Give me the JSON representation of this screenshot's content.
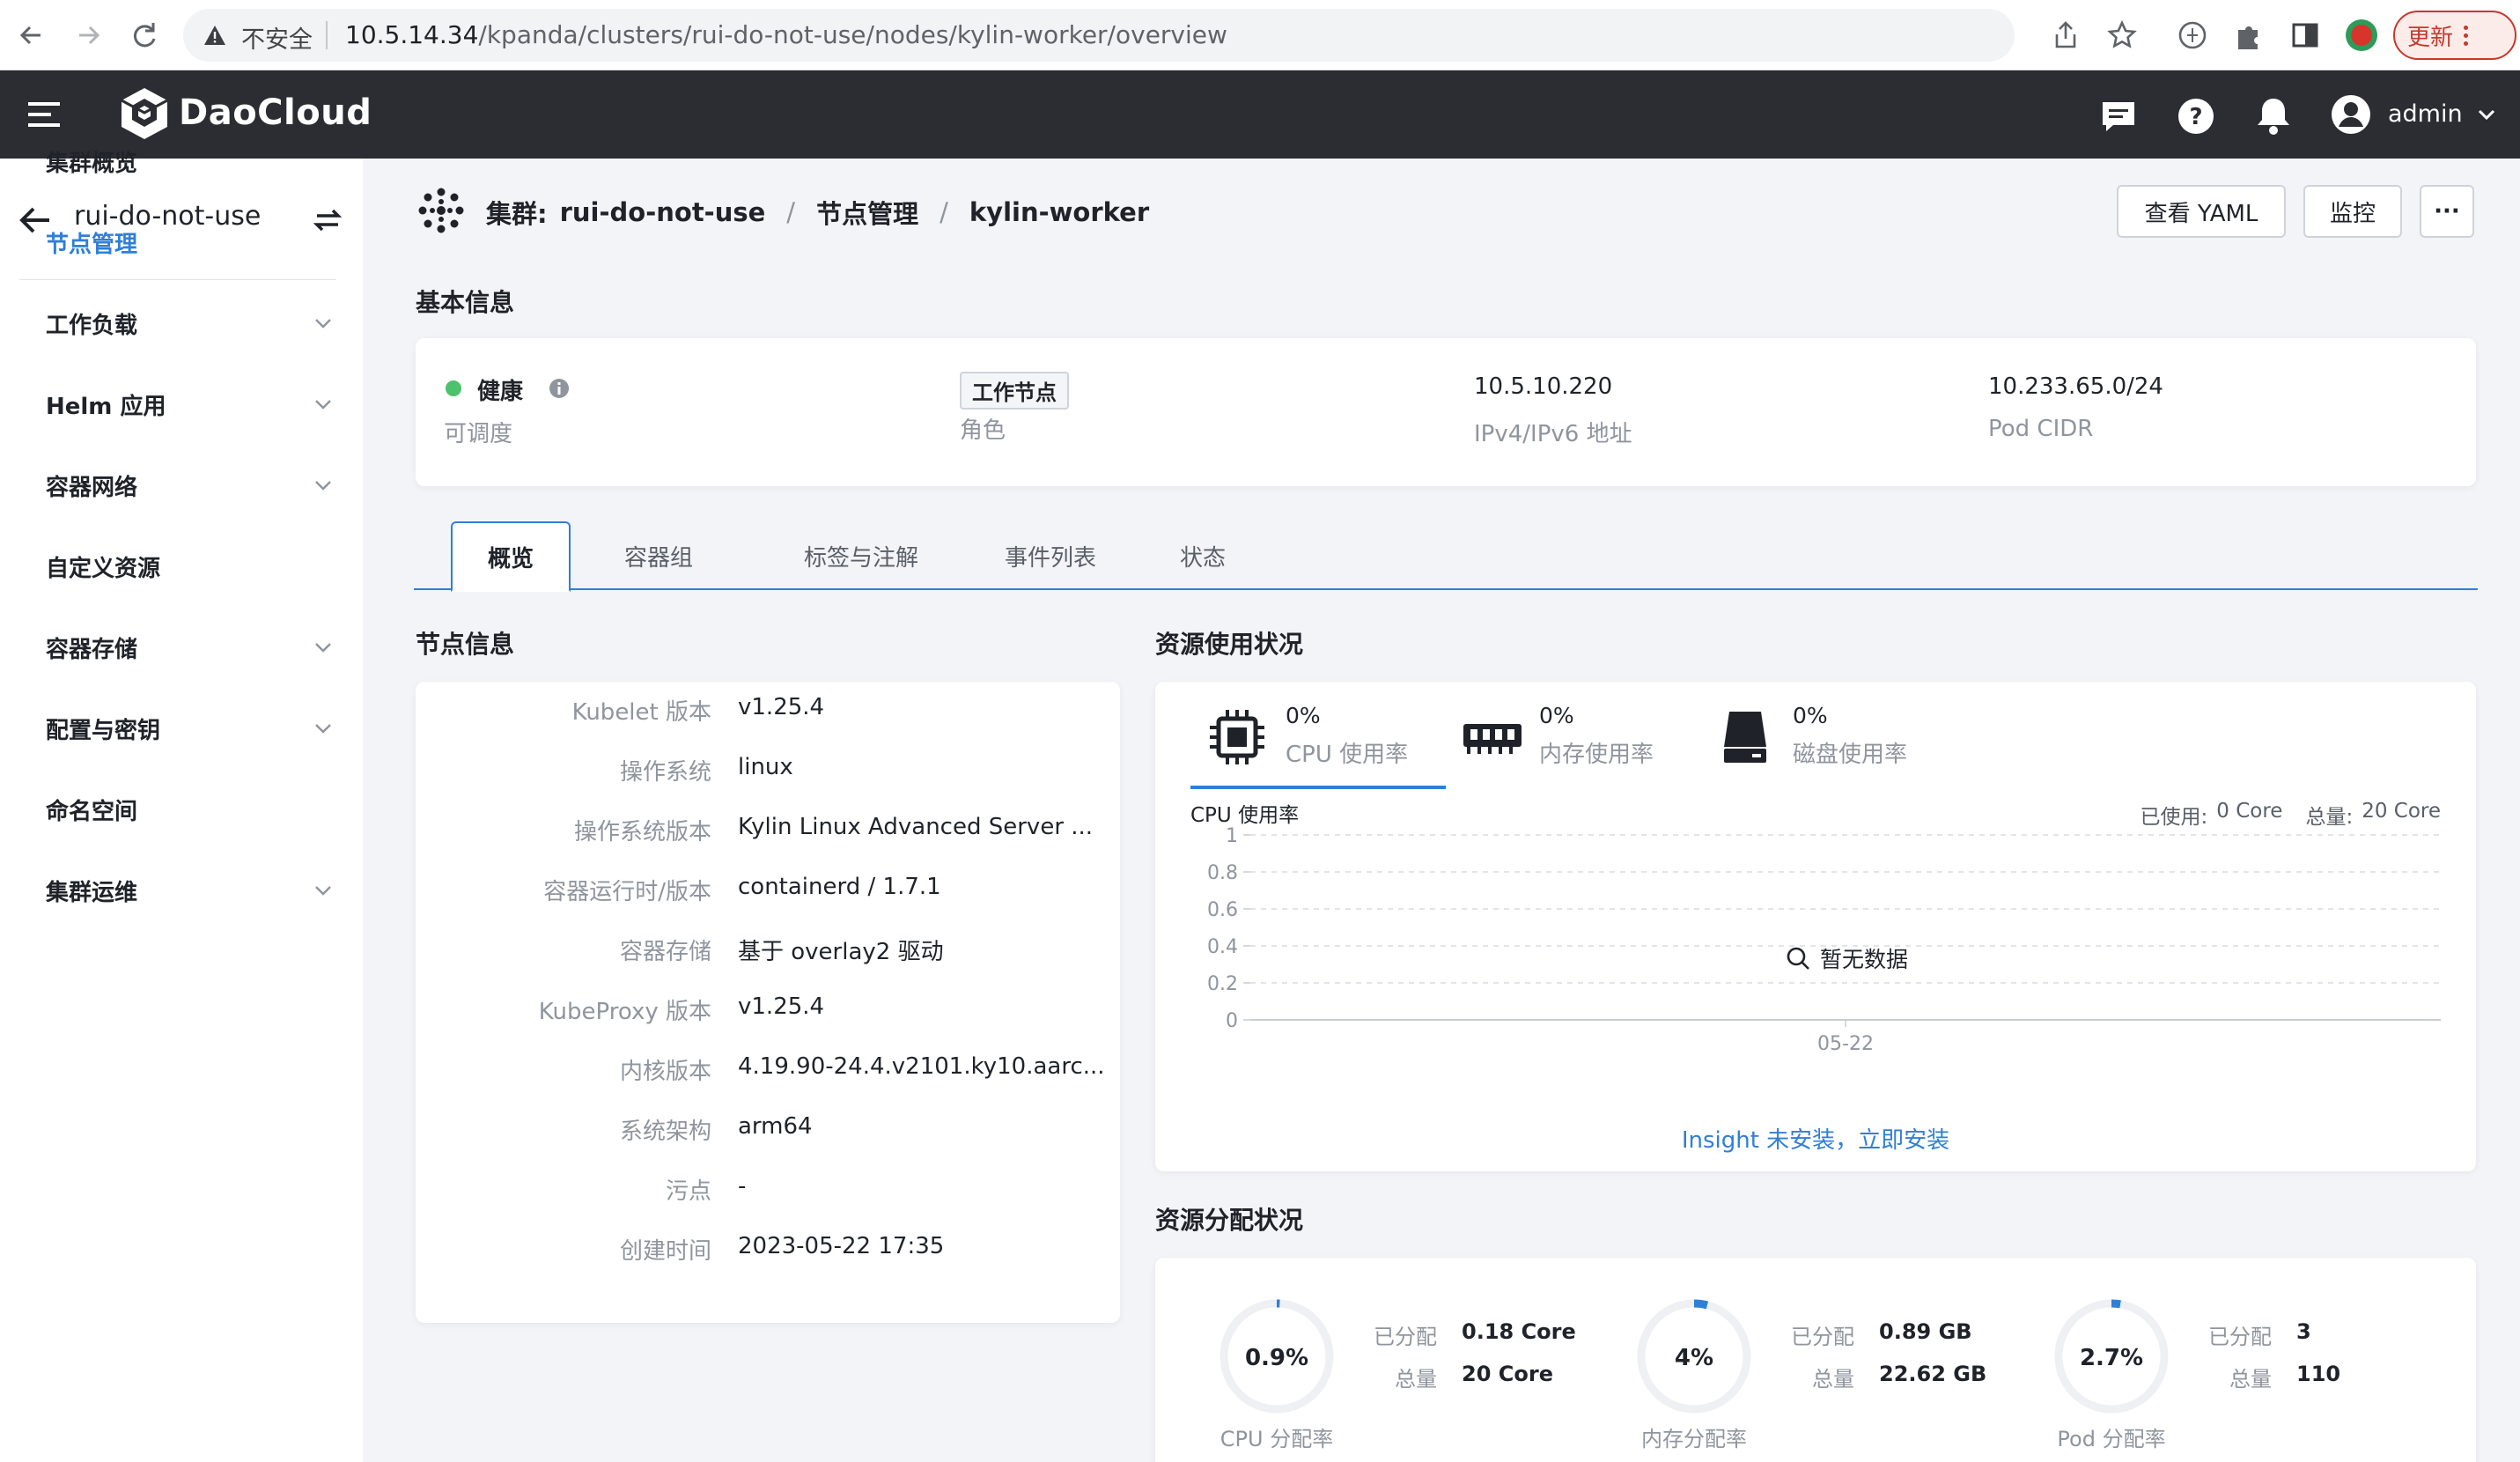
{
  "browser": {
    "security_label": "不安全",
    "url_host": "10.5.14.34",
    "url_path": "/kpanda/clusters/rui-do-not-use/nodes/kylin-worker/overview",
    "update_label": "更新"
  },
  "app": {
    "brand": "DaoCloud",
    "user": "admin"
  },
  "sidebar": {
    "cluster_name": "rui-do-not-use",
    "items": [
      {
        "label": "集群概览",
        "expandable": false
      },
      {
        "label": "节点管理",
        "expandable": false,
        "active": true
      },
      {
        "label": "工作负载",
        "expandable": true
      },
      {
        "label": "Helm 应用",
        "expandable": true
      },
      {
        "label": "容器网络",
        "expandable": true
      },
      {
        "label": "自定义资源",
        "expandable": false
      },
      {
        "label": "容器存储",
        "expandable": true
      },
      {
        "label": "配置与密钥",
        "expandable": true
      },
      {
        "label": "命名空间",
        "expandable": false
      },
      {
        "label": "集群运维",
        "expandable": true
      }
    ]
  },
  "breadcrumb": {
    "prefix": "集群:",
    "cluster": "rui-do-not-use",
    "section": "节点管理",
    "node": "kylin-worker"
  },
  "actions": {
    "yaml": "查看 YAML",
    "monitor": "监控",
    "more": "···"
  },
  "basic_info": {
    "title": "基本信息",
    "status": "健康",
    "status_label": "可调度",
    "role": "工作节点",
    "role_label": "角色",
    "ip": "10.5.10.220",
    "ip_label": "IPv4/IPv6 地址",
    "pod_cidr": "10.233.65.0/24",
    "pod_cidr_label": "Pod CIDR",
    "status_color": "#4cc26b"
  },
  "tabs": [
    "概览",
    "容器组",
    "标签与注解",
    "事件列表",
    "状态"
  ],
  "node_info": {
    "title": "节点信息",
    "rows": [
      {
        "k": "Kubelet 版本",
        "v": "v1.25.4"
      },
      {
        "k": "操作系统",
        "v": "linux"
      },
      {
        "k": "操作系统版本",
        "v": "Kylin Linux Advanced Server ..."
      },
      {
        "k": "容器运行时/版本",
        "v": "containerd / 1.7.1"
      },
      {
        "k": "容器存储",
        "v": "基于 overlay2 驱动"
      },
      {
        "k": "KubeProxy 版本",
        "v": "v1.25.4"
      },
      {
        "k": "内核版本",
        "v": "4.19.90-24.4.v2101.ky10.aarc..."
      },
      {
        "k": "系统架构",
        "v": "arm64"
      },
      {
        "k": "污点",
        "v": "-"
      },
      {
        "k": "创建时间",
        "v": "2023-05-22 17:35"
      }
    ]
  },
  "usage": {
    "title": "资源使用状况",
    "cpu_pct": "0%",
    "cpu_label": "CPU 使用率",
    "mem_pct": "0%",
    "mem_label": "内存使用率",
    "disk_pct": "0%",
    "disk_label": "磁盘使用率",
    "chart_title": "CPU 使用率",
    "used_label": "已使用:",
    "used_value": "0 Core",
    "total_label": "总量:",
    "total_value": "20 Core",
    "empty_text": "暂无数据",
    "insight_text": "Insight 未安装，立即安装"
  },
  "chart_data": {
    "type": "line",
    "title": "CPU 使用率",
    "x": [
      "05-22"
    ],
    "series": [],
    "ylim": [
      0,
      1
    ],
    "yticks": [
      "1",
      "0.8",
      "0.6",
      "0.4",
      "0.2",
      "0"
    ],
    "grid": true
  },
  "allocation": {
    "title": "资源分配状况",
    "items": [
      {
        "pct_text": "0.9%",
        "pct": 0.009,
        "alloc_label": "已分配",
        "alloc": "0.18 Core",
        "total_label": "总量",
        "total": "20 Core",
        "label": "CPU 分配率"
      },
      {
        "pct_text": "4%",
        "pct": 0.04,
        "alloc_label": "已分配",
        "alloc": "0.89 GB",
        "total_label": "总量",
        "total": "22.62 GB",
        "label": "内存分配率"
      },
      {
        "pct_text": "2.7%",
        "pct": 0.027,
        "alloc_label": "已分配",
        "alloc": "3",
        "total_label": "总量",
        "total": "110",
        "label": "Pod 分配率"
      }
    ],
    "ring_color": "#2f7fd8"
  }
}
